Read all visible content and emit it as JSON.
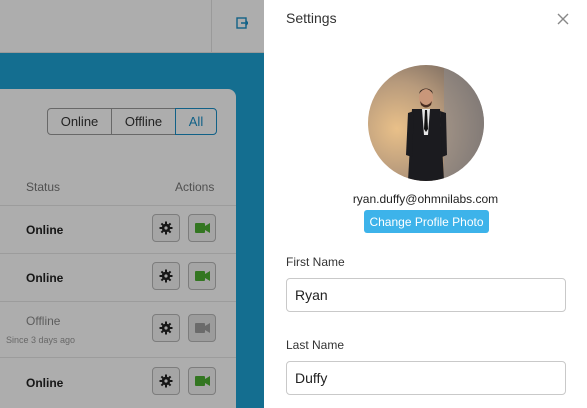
{
  "background": {
    "filters": {
      "online": "Online",
      "offline": "Offline",
      "all": "All",
      "active": "All"
    },
    "columns": {
      "status": "Status",
      "actions": "Actions"
    },
    "rows": [
      {
        "status": "Online",
        "since": "",
        "video_enabled": true
      },
      {
        "status": "Online",
        "since": "",
        "video_enabled": true
      },
      {
        "status": "Offline",
        "since": "Since 3 days ago",
        "video_enabled": false
      },
      {
        "status": "Online",
        "since": "",
        "video_enabled": true
      }
    ],
    "icons": {
      "topbar": "logout-icon",
      "settings": "gear-icon",
      "video": "video-camera-icon"
    }
  },
  "settings": {
    "title": "Settings",
    "close_icon": "close-icon",
    "email": "ryan.duffy@ohmnilabs.com",
    "change_photo_label": "Change Profile Photo",
    "first_name": {
      "label": "First Name",
      "value": "Ryan"
    },
    "last_name": {
      "label": "Last Name",
      "value": "Duffy"
    }
  },
  "colors": {
    "accent": "#3db3ea",
    "band": "#1ea2d4",
    "video_green": "#4caf32"
  }
}
